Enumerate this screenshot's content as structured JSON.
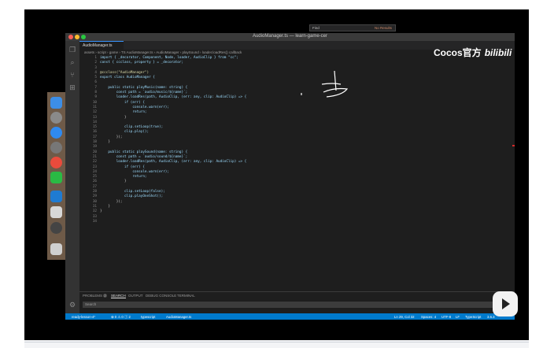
{
  "window": {
    "title": "AudioManager.ts — learn-game-cer"
  },
  "tab": {
    "label": "AudioManager.ts"
  },
  "breadcrumb": "assets › script › game › TS AudioManager.ts › AudioManager › playSound › loader.loadRes() callback",
  "find": {
    "label": "Find",
    "result": "No Results"
  },
  "watermark": {
    "brand": "Cocos官方",
    "site": "bilibili"
  },
  "code": {
    "line_numbers": [
      "1",
      "2",
      "3",
      "4",
      "5",
      "6",
      "7",
      "8",
      "9",
      "10",
      "11",
      "12",
      "13",
      "14",
      "15",
      "16",
      "17",
      "18",
      "19",
      "20",
      "21",
      "22",
      "23",
      "24",
      "25",
      "26",
      "27",
      "28",
      "29",
      "30",
      "31",
      "32",
      "33",
      "34"
    ],
    "lines": [
      "import { _decorator, Component, Node, loader, AudioClip } from \"cc\";",
      "const { ccclass, property } = _decorator;",
      "",
      "@ccclass(\"AudioManager\")",
      "export class AudioManager {",
      "",
      "    public static playMusic(name: string) {",
      "        const path = `audio/music/${name}`;",
      "        loader.loadRes(path, AudioClip, (err: any, clip: AudioClip) => {",
      "            if (err) {",
      "                console.warn(err);",
      "                return;",
      "            }",
      "",
      "            clip.setLoop(true);",
      "            clip.play();",
      "        });",
      "    }",
      "",
      "    public static playSound(name: string) {",
      "        const path = `audio/sound/${name}`;",
      "        loader.loadRes(path, AudioClip, (err: any, clip: AudioClip) => {",
      "            if (err) {",
      "                console.warn(err);",
      "                return;",
      "            }",
      "",
      "            clip.setLoop(false);",
      "            clip.playOneShot();",
      "        });",
      "    }",
      "}",
      "",
      ""
    ]
  },
  "panel": {
    "tabs": [
      "PROBLEMS",
      "SEARCH",
      "OUTPUT",
      "DEBUG CONSOLE",
      "TERMINAL"
    ],
    "problems_count": "2",
    "search_placeholder": "Search"
  },
  "statusbar": {
    "branch": "ready-lesson-4*",
    "errors": "⊗ 0 ⚠ 0 ⓘ 2",
    "lang_left": "typescript",
    "file": "AudioManager.ts",
    "position": "Ln 29, Col 32",
    "spaces": "Spaces: 4",
    "encoding": "UTF-8",
    "eol": "LF",
    "language": "TypeScript",
    "version": "3.6.3"
  },
  "colors": {
    "accent": "#007acc",
    "keyword": "#c586c0",
    "type": "#4ec9b0",
    "string": "#ce9178",
    "function": "#dcdcaa",
    "variable": "#9cdcfe"
  }
}
